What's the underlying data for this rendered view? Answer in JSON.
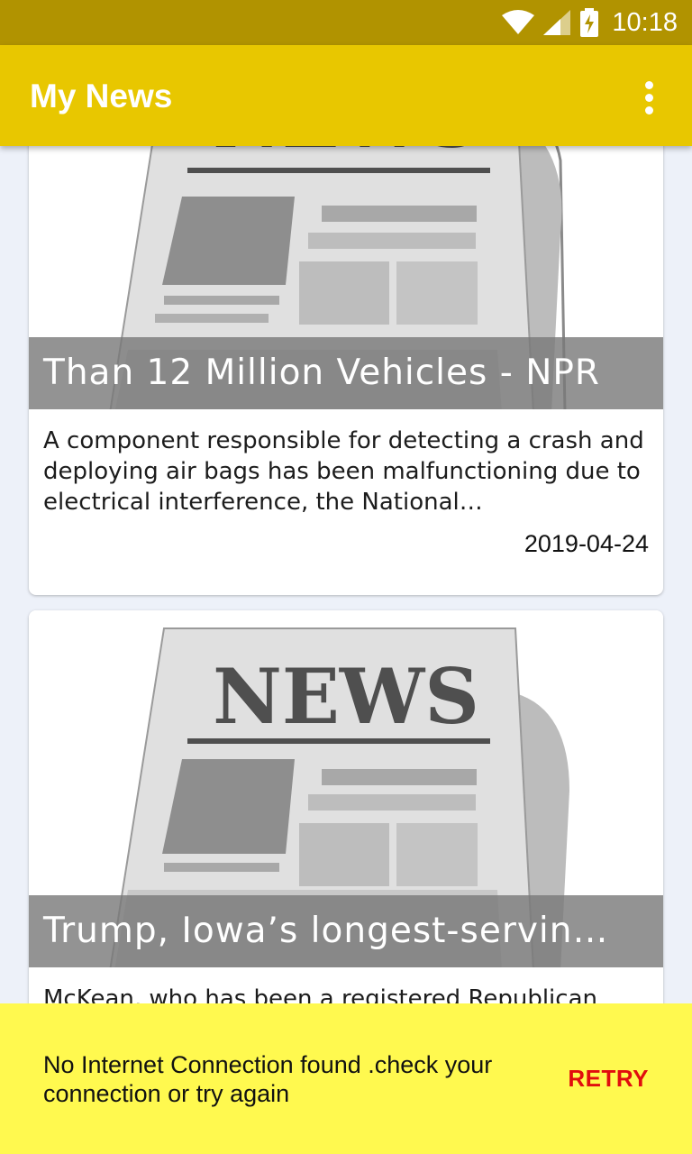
{
  "status_bar": {
    "time": "10:18",
    "icons": [
      "wifi-icon",
      "cell-signal-icon",
      "battery-charging-icon"
    ]
  },
  "app_bar": {
    "title": "My News",
    "overflow_icon": "more-vert-icon"
  },
  "articles": [
    {
      "image_masthead": "NEWS",
      "title": "Than 12 Million Vehicles - NPR",
      "description": "A component responsible for detecting a crash and deploying air bags has been malfunctioning due to electrical interference, the National…",
      "date": "2019-04-24"
    },
    {
      "image_masthead": "NEWS",
      "title": "Trump, Iowa’s longest-servin…",
      "description": "McKean, who has been a registered Republican"
    }
  ],
  "snackbar": {
    "message": "No Internet Connection found .check your connection or try again",
    "action": "RETRY"
  },
  "colors": {
    "status_bar": "#b19300",
    "app_bar": "#e8c700",
    "background": "#edf1f9",
    "snackbar": "#fff94f",
    "snackbar_action": "#e10e0e"
  }
}
